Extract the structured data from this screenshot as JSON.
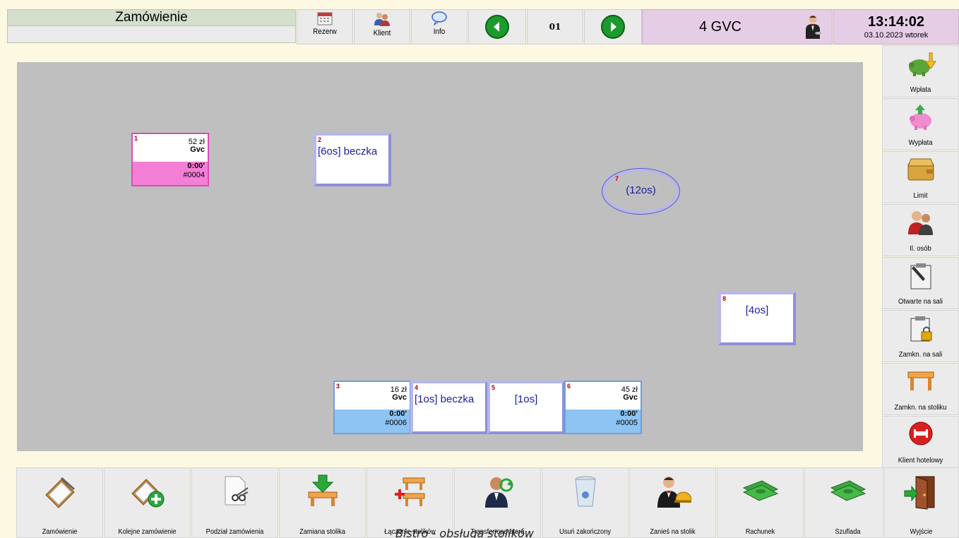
{
  "header": {
    "title": "Zamówienie",
    "subtitle": "",
    "buttons": [
      {
        "label": "Rezerw",
        "icon": "calendar-icon"
      },
      {
        "label": "Klient",
        "icon": "people-icon"
      },
      {
        "label": "Info",
        "icon": "speech-bubble-icon"
      }
    ],
    "prev_icon": "arrow-left-icon",
    "next_icon": "arrow-right-icon",
    "page": "01",
    "station": "4 GVC",
    "time": "13:14:02",
    "date": "03.10.2023 wtorek"
  },
  "tables": [
    {
      "num": "1",
      "type": "occupied",
      "color": "#f37fd6",
      "amount": "52 zł",
      "client": "Gvc",
      "time": "0:00'",
      "order": "#0004"
    },
    {
      "num": "2",
      "type": "free",
      "label": "[6os] beczka"
    },
    {
      "num": "7",
      "type": "round",
      "label": "(12os)"
    },
    {
      "num": "8",
      "type": "free",
      "label": "[4os]"
    },
    {
      "num": "3",
      "type": "occupied",
      "color": "#8ec4f2",
      "amount": "16 zł",
      "client": "Gvc",
      "time": "0:00'",
      "order": "#0006"
    },
    {
      "num": "4",
      "type": "free",
      "label": "[1os] beczka"
    },
    {
      "num": "5",
      "type": "free",
      "label": "[1os]"
    },
    {
      "num": "6",
      "type": "occupied",
      "color": "#8ec4f2",
      "amount": "45 zł",
      "client": "Gvc",
      "time": "0:00'",
      "order": "#0005"
    }
  ],
  "side_buttons": [
    {
      "label": "Wpłata",
      "icon": "pig-deposit-icon"
    },
    {
      "label": "Wypłata",
      "icon": "pig-withdraw-icon"
    },
    {
      "label": "Limit",
      "icon": "wallet-icon"
    },
    {
      "label": "Il. osób",
      "icon": "people-count-icon"
    },
    {
      "label": "Otwarte na sali",
      "icon": "clipboard-pen-icon"
    },
    {
      "label": "Zamkn. na sali",
      "icon": "clipboard-lock-icon"
    },
    {
      "label": "Zamkn. na stoliku",
      "icon": "table-icon"
    },
    {
      "label": "Klient hotelowy",
      "icon": "hotel-bed-icon"
    }
  ],
  "bottom_buttons": [
    {
      "label": "Zamówienie",
      "icon": "clipboard-icon"
    },
    {
      "label": "Kolejne zamówienie",
      "icon": "clipboard-plus-icon"
    },
    {
      "label": "Podział zamówienia",
      "icon": "scissors-icon"
    },
    {
      "label": "Zamiana stolika",
      "icon": "table-swap-icon"
    },
    {
      "label": "Łączenie stolików",
      "icon": "table-join-icon"
    },
    {
      "label": "Transfer operatora",
      "icon": "operator-transfer-icon"
    },
    {
      "label": "Usuń zakończony",
      "icon": "trash-icon"
    },
    {
      "label": "Zanieś na stolik",
      "icon": "waiter-serve-icon"
    },
    {
      "label": "Rachunek",
      "icon": "money-icon"
    },
    {
      "label": "Szuflada",
      "icon": "money-drawer-icon"
    },
    {
      "label": "Wyjście",
      "icon": "exit-door-icon"
    }
  ],
  "caption": "Bistro - obsługa stolików"
}
